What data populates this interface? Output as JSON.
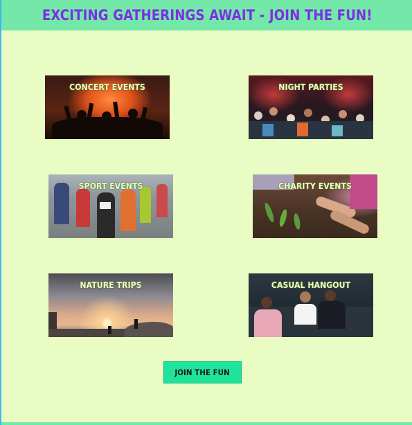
{
  "header": {
    "title": "EXCITING GATHERINGS AWAIT - JOIN THE FUN!"
  },
  "events": [
    {
      "label": "CONCERT EVENTS",
      "image": "concert-crowd-image"
    },
    {
      "label": "NIGHT PARTIES",
      "image": "party-crowd-image"
    },
    {
      "label": "SPORT EVENTS",
      "image": "marathon-runners-image"
    },
    {
      "label": "CHARITY EVENTS",
      "image": "planting-hands-image"
    },
    {
      "label": "NATURE TRIPS",
      "image": "mountain-sunset-hikers-image"
    },
    {
      "label": "CASUAL HANGOUT",
      "image": "friends-cinema-image"
    }
  ],
  "cta": {
    "label": "JOIN THE FUN"
  },
  "colors": {
    "background": "#e9fcc3",
    "header_bg": "#74e8a8",
    "title": "#7c2fe6",
    "button": "#1fe39b"
  }
}
